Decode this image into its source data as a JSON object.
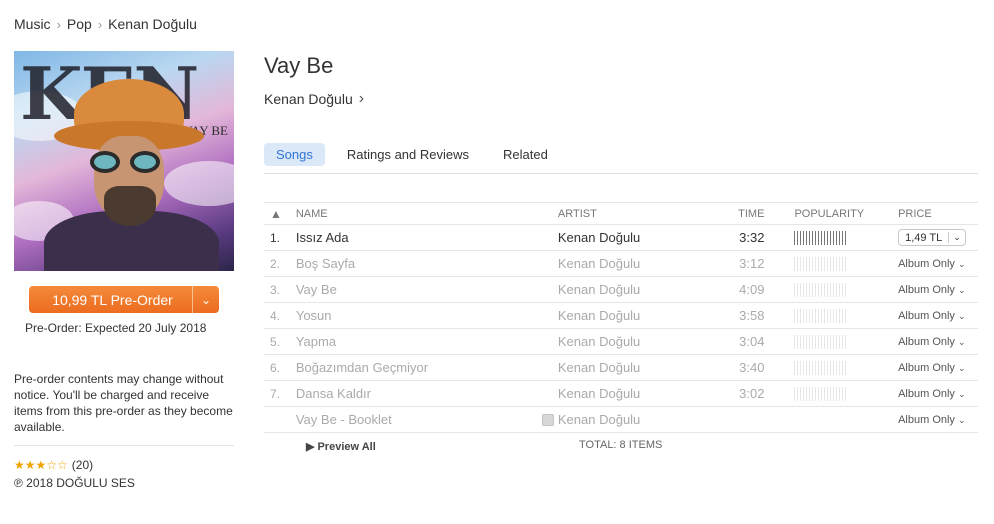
{
  "breadcrumb": {
    "items": [
      "Music",
      "Pop",
      "Kenan Doğulu"
    ]
  },
  "album": {
    "art_logo": "KEN",
    "art_title": "VAY BE",
    "title": "Vay Be",
    "artist": "Kenan Doğulu",
    "preorder_label": "10,99 TL Pre-Order",
    "expected": "Pre-Order: Expected 20 July 2018",
    "notice": "Pre-order contents may change without notice. You'll be charged and receive items from this pre-order as they become available.",
    "stars": "★★★☆☆",
    "rating_count": "(20)",
    "copyright": "℗ 2018 DOĞULU SES"
  },
  "tabs": [
    {
      "label": "Songs",
      "active": true
    },
    {
      "label": "Ratings and Reviews",
      "active": false
    },
    {
      "label": "Related",
      "active": false
    }
  ],
  "table": {
    "sort_icon": "▲",
    "headers": {
      "name": "NAME",
      "artist": "ARTIST",
      "time": "TIME",
      "popularity": "POPULARITY",
      "price": "PRICE"
    },
    "rows": [
      {
        "num": "1.",
        "name": "Issız Ada",
        "artist": "Kenan Doğulu",
        "time": "3:32",
        "popularity": 0.9,
        "price": "1,49 TL",
        "playable": true
      },
      {
        "num": "2.",
        "name": "Boş Sayfa",
        "artist": "Kenan Doğulu",
        "time": "3:12",
        "popularity": 0.9,
        "price": "Album Only",
        "playable": false
      },
      {
        "num": "3.",
        "name": "Vay Be",
        "artist": "Kenan Doğulu",
        "time": "4:09",
        "popularity": 0.9,
        "price": "Album Only",
        "playable": false
      },
      {
        "num": "4.",
        "name": "Yosun",
        "artist": "Kenan Doğulu",
        "time": "3:58",
        "popularity": 0.9,
        "price": "Album Only",
        "playable": false
      },
      {
        "num": "5.",
        "name": "Yapma",
        "artist": "Kenan Doğulu",
        "time": "3:04",
        "popularity": 0.9,
        "price": "Album Only",
        "playable": false
      },
      {
        "num": "6.",
        "name": "Boğazımdan Geçmiyor",
        "artist": "Kenan Doğulu",
        "time": "3:40",
        "popularity": 0.9,
        "price": "Album Only",
        "playable": false
      },
      {
        "num": "7.",
        "name": "Dansa Kaldır",
        "artist": "Kenan Doğulu",
        "time": "3:02",
        "popularity": 0.9,
        "price": "Album Only",
        "playable": false
      },
      {
        "num": "",
        "name": "Vay Be - Booklet",
        "artist": "Kenan Doğulu",
        "time": "",
        "popularity": null,
        "price": "Album Only",
        "playable": false,
        "booklet": true
      }
    ],
    "preview_all": "Preview All",
    "total": "TOTAL: 8 ITEMS"
  },
  "colors": {
    "accent_orange": "#ec6c20",
    "tab_active_bg": "#dbe8f8",
    "tab_active_text": "#2f75d6",
    "star": "#f0a400"
  },
  "icons": [
    "chevron-right-icon",
    "chevron-down-icon",
    "sort-up-icon",
    "play-icon",
    "document-icon"
  ]
}
